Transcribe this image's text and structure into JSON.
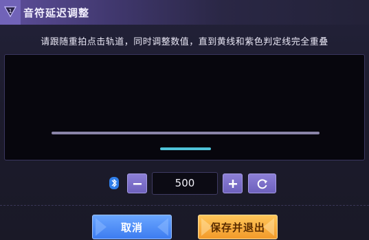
{
  "dialog": {
    "title": "音符延迟调整",
    "instruction": "请跟随重拍点击轨道，同时调整数值，直到黄线和紫色判定线完全重叠"
  },
  "controls": {
    "bluetooth_icon": "bluetooth-icon",
    "decrease_icon": "minus-icon",
    "offset_value": "500",
    "increase_icon": "plus-icon",
    "reset_icon": "refresh-icon"
  },
  "buttons": {
    "cancel_label": "取消",
    "save_label": "保存并退出"
  },
  "colors": {
    "accent_purple": "#6e61bd",
    "judge_line": "#8a84a8",
    "note_line": "#4fc3d9",
    "cancel": "#3d7cf0",
    "save": "#f29a2a"
  }
}
